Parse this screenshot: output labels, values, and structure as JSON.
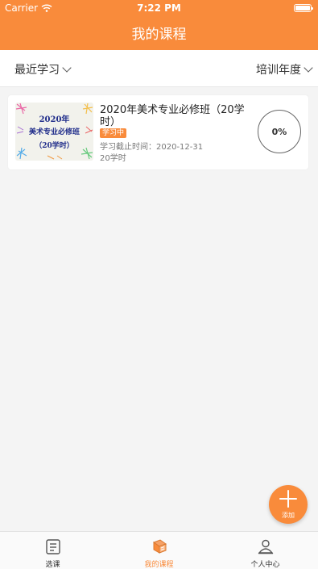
{
  "status_bar": {
    "carrier": "Carrier",
    "time": "7:22 PM"
  },
  "nav": {
    "title": "我的课程"
  },
  "filters": {
    "left_label": "最近学习",
    "right_label": "培训年度"
  },
  "courses": [
    {
      "thumbnail_lines": [
        "2020年",
        "美术专业必修班",
        "（20学时）"
      ],
      "title": "2020年美术专业必修班（20学时）",
      "status": "学习中",
      "deadline": "学习截止时间：2020-12-31",
      "hours": "20学时",
      "progress": "0%"
    }
  ],
  "fab": {
    "label": "添加"
  },
  "tabs": [
    {
      "label": "选课",
      "icon": "course-select-icon",
      "active": false
    },
    {
      "label": "我的课程",
      "icon": "my-courses-icon",
      "active": true
    },
    {
      "label": "个人中心",
      "icon": "profile-icon",
      "active": false
    }
  ],
  "colors": {
    "accent": "#f98b3b",
    "background": "#f4f4f4",
    "thumb_text": "#1f2c8a"
  }
}
